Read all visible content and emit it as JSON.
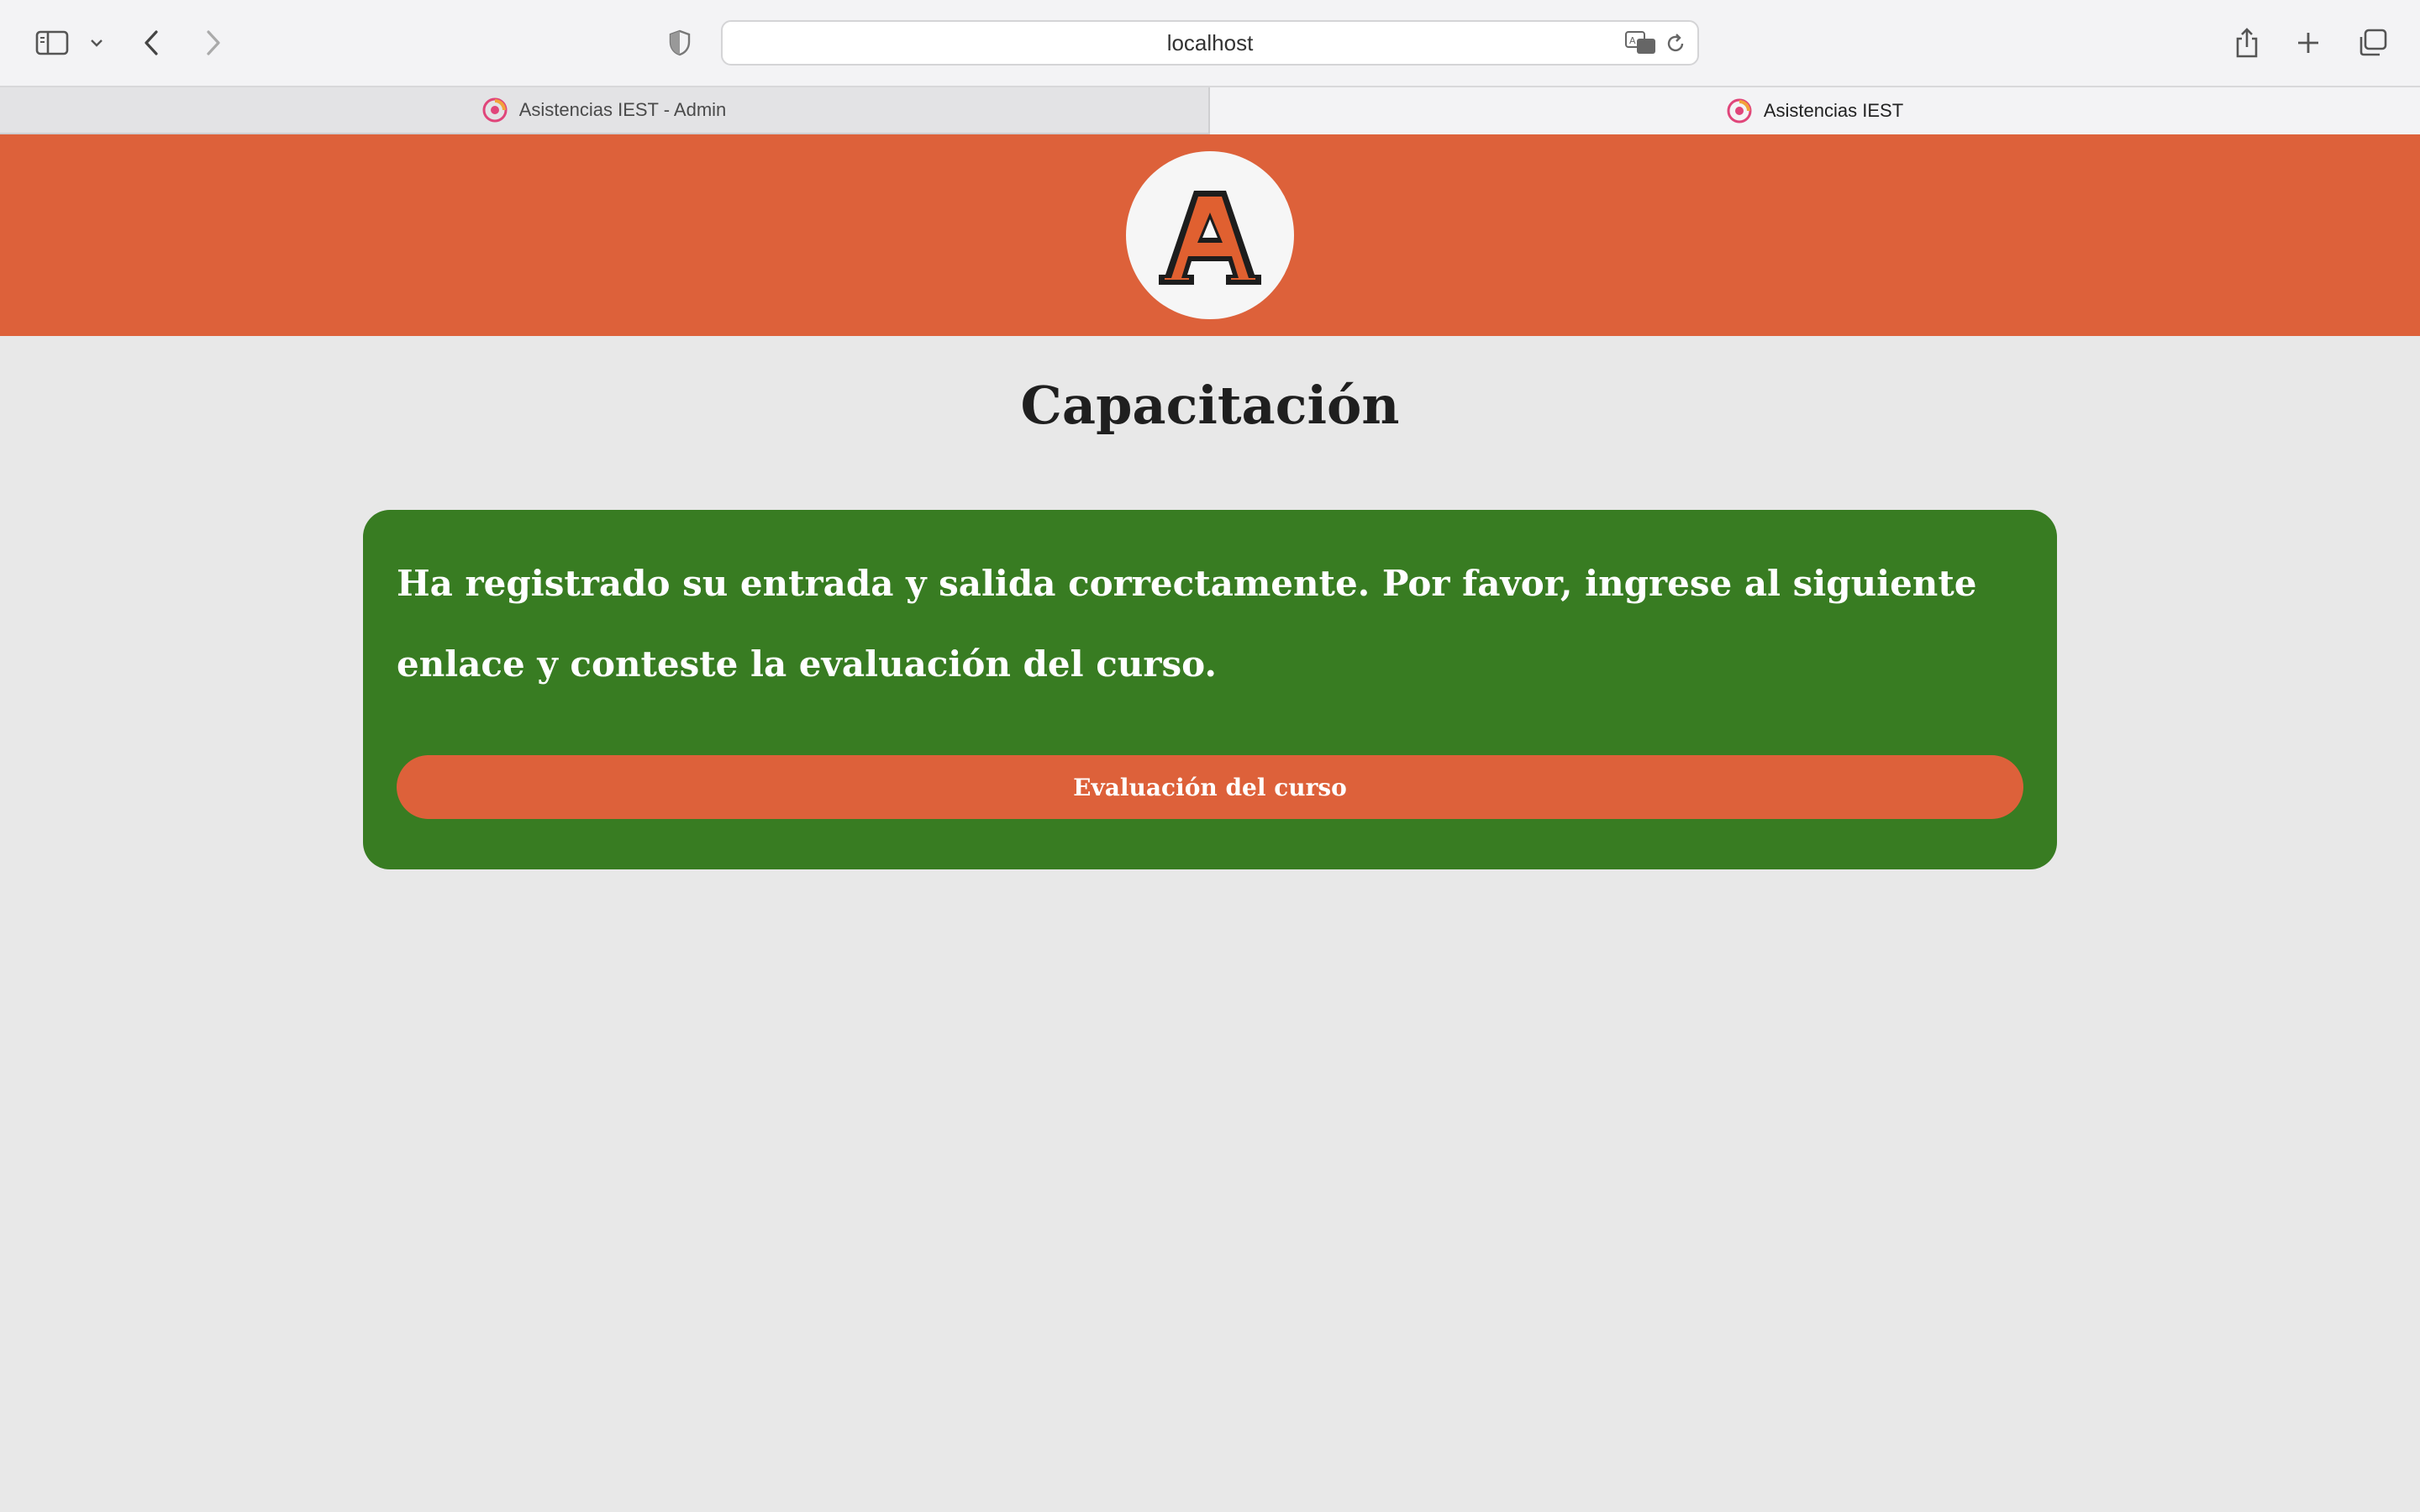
{
  "browser": {
    "url": "localhost",
    "tabs": [
      {
        "label": "Asistencias IEST - Admin",
        "active": false
      },
      {
        "label": "Asistencias IEST",
        "active": true
      }
    ],
    "icons": [
      "sidebar-icon",
      "chevron-down-icon",
      "back-icon",
      "forward-icon",
      "shield-icon",
      "translate-icon",
      "reload-icon",
      "share-icon",
      "new-tab-icon",
      "tab-overview-icon"
    ]
  },
  "page": {
    "logo_letter": "A",
    "title": "Capacitación",
    "message": "Ha registrado su entrada y salida correctamente. Por favor, ingrese al siguiente enlace y conteste la evaluación del curso.",
    "button_label": "Evaluación del curso"
  },
  "colors": {
    "brand_orange": "#dd613a",
    "success_green": "#387c22",
    "page_background": "#e8e8e8"
  }
}
